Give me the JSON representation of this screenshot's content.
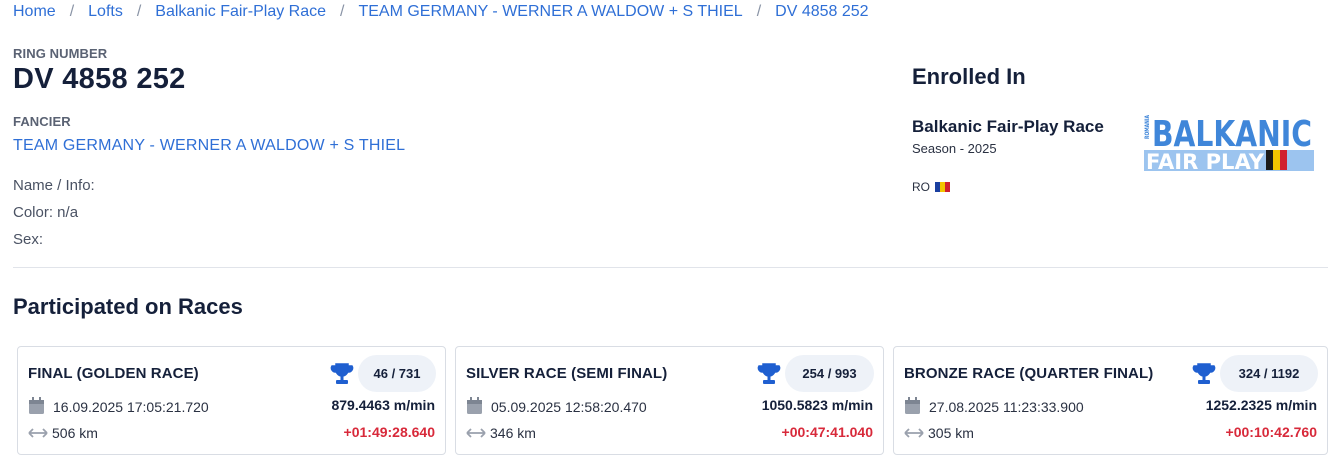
{
  "breadcrumb": [
    "Home",
    "Lofts",
    "Balkanic Fair-Play Race",
    "TEAM GERMANY - WERNER A WALDOW + S THIEL",
    "DV 4858 252"
  ],
  "ring": {
    "label": "RING NUMBER",
    "value": "DV 4858 252"
  },
  "fancier": {
    "label": "FANCIER",
    "name": "TEAM GERMANY - WERNER A WALDOW + S THIEL"
  },
  "info": {
    "name": "Name / Info:",
    "color": "Color: n/a",
    "sex": "Sex:"
  },
  "enrolled": {
    "title": "Enrolled In",
    "race": "Balkanic Fair-Play Race",
    "season": "Season - 2025",
    "country": "RO",
    "logo_main": "BALKANIC",
    "logo_sub": "FAIR PLAY",
    "logo_side": "ROMANIA"
  },
  "colors": {
    "link": "#2f6fd6",
    "trophy": "#1f5fd0",
    "diff": "#d8293a",
    "logo": "#3f86d9",
    "logo_light": "#9cc4ef"
  },
  "section_title": "Participated on Races",
  "races": [
    {
      "title": "FINAL (GOLDEN RACE)",
      "rank": "46 / 731",
      "date": "16.09.2025 17:05:21.720",
      "speed": "879.4463 m/min",
      "distance": "506 km",
      "diff": "+01:49:28.640"
    },
    {
      "title": "SILVER RACE (SEMI FINAL)",
      "rank": "254 / 993",
      "date": "05.09.2025 12:58:20.470",
      "speed": "1050.5823 m/min",
      "distance": "346 km",
      "diff": "+00:47:41.040"
    },
    {
      "title": "BRONZE RACE (QUARTER FINAL)",
      "rank": "324 / 1192",
      "date": "27.08.2025 11:23:33.900",
      "speed": "1252.2325 m/min",
      "distance": "305 km",
      "diff": "+00:10:42.760"
    }
  ]
}
